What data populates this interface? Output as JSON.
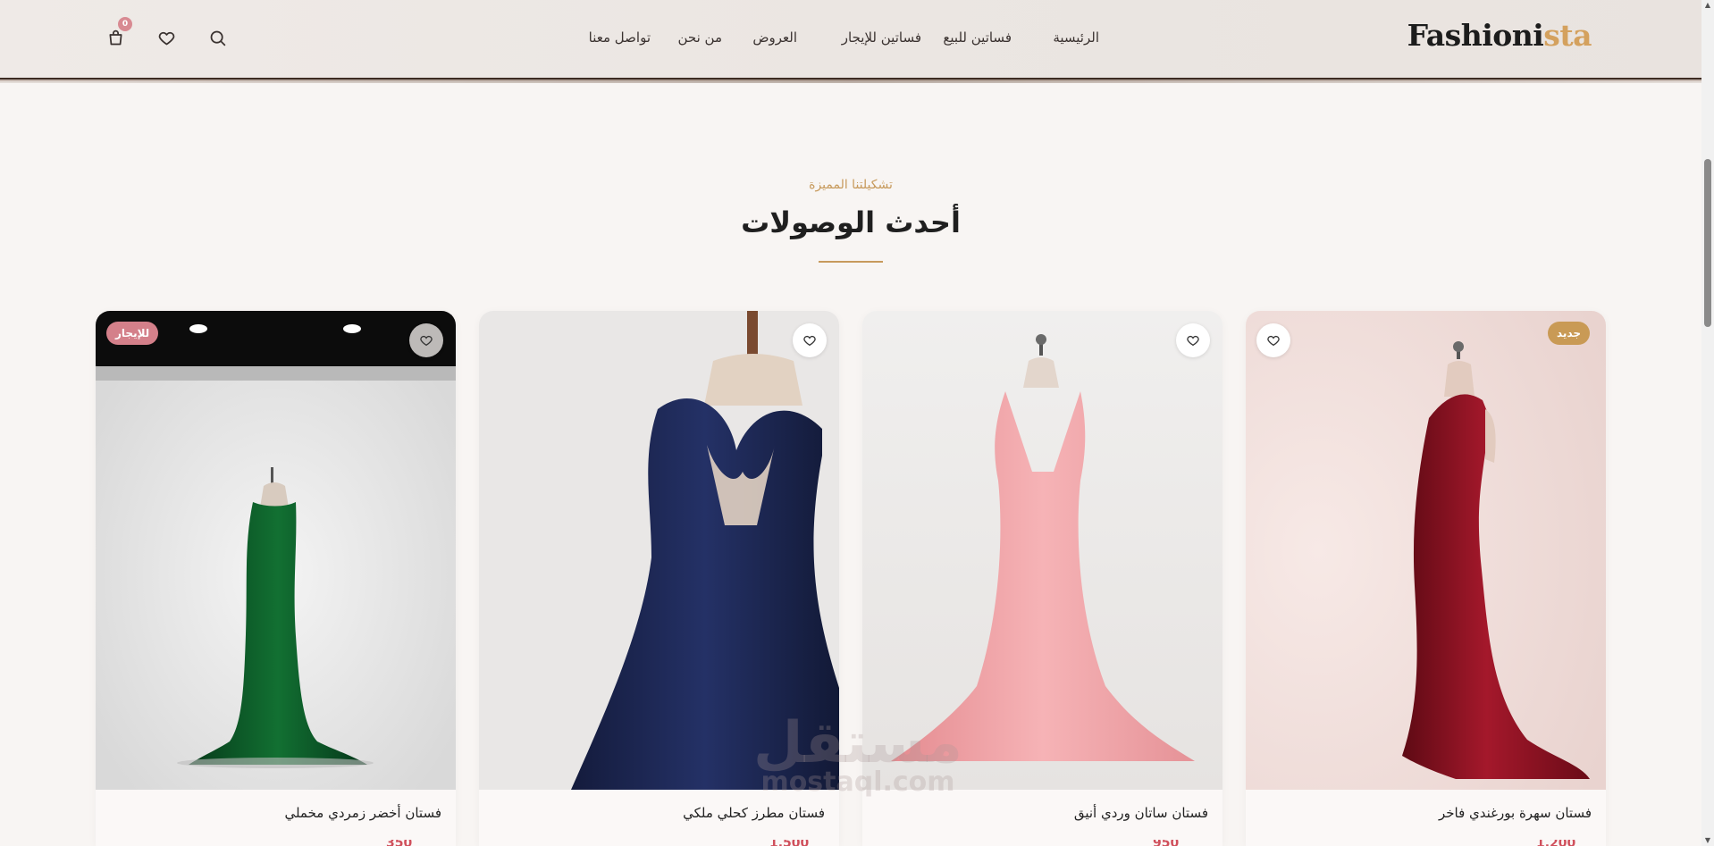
{
  "header": {
    "logo_main": "Fashioni",
    "logo_accent": "sta",
    "cart_count": "0",
    "nav": [
      {
        "label": "الرئيسية"
      },
      {
        "label": "فساتين للبيع"
      },
      {
        "label": "فساتين للإيجار"
      },
      {
        "label": "العروض"
      },
      {
        "label": "من نحن"
      },
      {
        "label": "تواصل معنا"
      }
    ],
    "icons": {
      "search": "search-icon",
      "wishlist": "heart-icon",
      "cart": "shopping-bag-icon"
    }
  },
  "section": {
    "eyebrow": "تشكيلتنا المميزة",
    "title": "أحدث الوصولات"
  },
  "products": [
    {
      "name": "فستان سهرة بورغندي فاخر",
      "badge": "جديد",
      "badge_color": "#c99a55",
      "dress_color": "#8c0f1e"
    },
    {
      "name": "فستان ساتان وردي أنيق",
      "badge": "",
      "dress_color": "#f0a1a4"
    },
    {
      "name": "فستان مطرز كحلي ملكي",
      "badge": "",
      "dress_color": "#1b2550"
    },
    {
      "name": "فستان أخضر زمردي مخملي",
      "badge": "للإيجار",
      "badge_color": "#d4808a",
      "dress_color": "#0f5a2a"
    }
  ],
  "watermark": {
    "arabic": "مستقل",
    "latin": "mostaql.com"
  },
  "colors": {
    "accent": "#c79a5c",
    "price": "#d0505c"
  }
}
